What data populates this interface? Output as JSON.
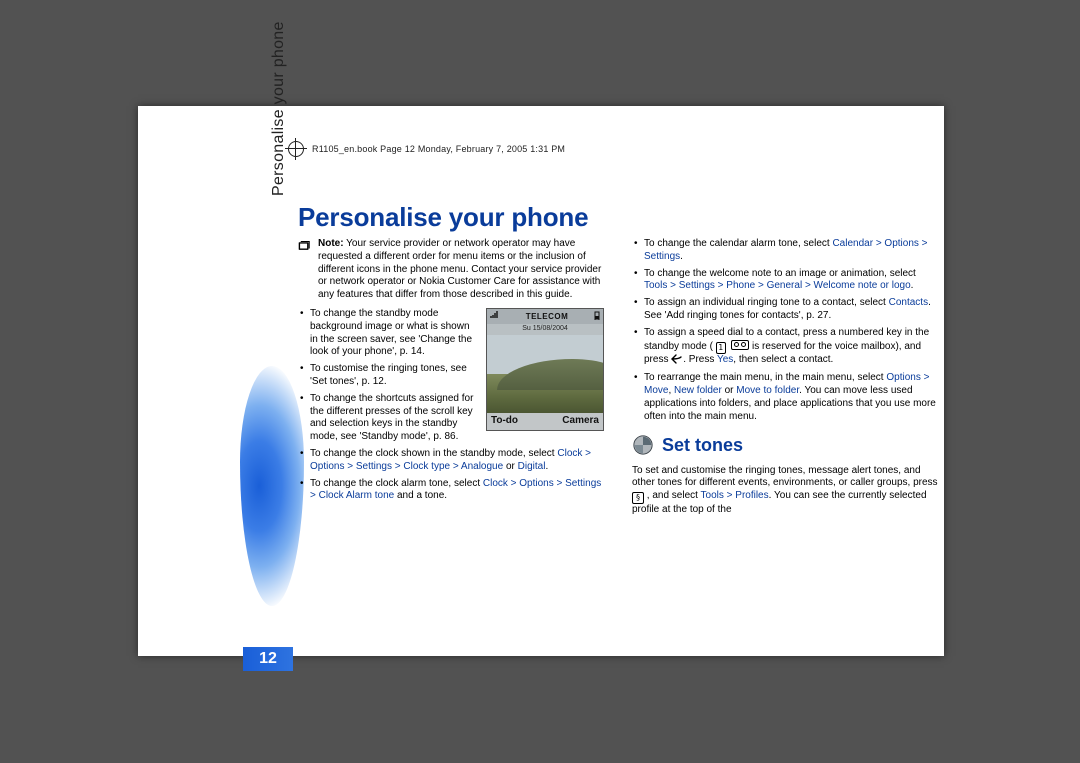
{
  "header_print_line": "R1105_en.book  Page 12  Monday, February 7, 2005  1:31 PM",
  "vtab": "Personalise your phone",
  "page_number": "12",
  "title": "Personalise your phone",
  "note_label": "Note:",
  "note_text": " Your service provider or network operator may have requested a different order for menu items or the inclusion of different icons in the phone menu. Contact your service provider or network operator or Nokia Customer Care for assistance with any features that differ from those described in this guide.",
  "left_bullets": {
    "b1": "To change the standby mode background image or what is shown in the screen saver, see 'Change the look of your phone', p. 14.",
    "b2": "To customise the ringing tones, see 'Set tones', p. 12.",
    "b3": "To change the shortcuts assigned for the different presses of the scroll key and selection keys in the standby mode, see 'Standby mode', p. 86.",
    "b4_pre": "To change the clock shown in the standby mode, select ",
    "b4_link": "Clock > Options > Settings > Clock type > Analogue",
    "b4_mid": " or ",
    "b4_link2": "Digital",
    "b4_post": ".",
    "b5_pre": "To change the clock alarm tone, select ",
    "b5_link": "Clock > Options > Settings > Clock Alarm tone",
    "b5_post": " and a tone."
  },
  "right_bullets": {
    "r1_pre": "To change the calendar alarm tone, select ",
    "r1_link": "Calendar > Options > Settings",
    "r1_post": ".",
    "r2_pre": "To change the welcome note to an image or animation, select ",
    "r2_link": "Tools > Settings > Phone > General > Welcome note or logo",
    "r2_post": ".",
    "r3_pre": "To assign an individual ringing tone to a contact, select ",
    "r3_link": "Contacts",
    "r3_post": ". See 'Add ringing tones for contacts', p. 27.",
    "r4_pre": "To assign a speed dial to a contact, press a numbered key in the standby mode ( ",
    "r4_mid": " is reserved for the voice mailbox), and press ",
    "r4_mid2": ". Press ",
    "r4_link": "Yes",
    "r4_post": ", then select a contact.",
    "r5_pre": "To rearrange the main menu, in the main menu, select ",
    "r5_link1": "Options > Move",
    "r5_mid1": ", ",
    "r5_link2": "New folder",
    "r5_mid2": " or ",
    "r5_link3": "Move to folder",
    "r5_post": ". You can move less used applications into folders, and place applications that you use more often into the main menu."
  },
  "section_title": "Set tones",
  "section_para_pre": "To set and customise the ringing tones, message alert tones, and other tones for different events, environments, or caller groups, press ",
  "section_para_mid": " , and select ",
  "section_para_link": "Tools > Profiles",
  "section_para_post": ". You can see the currently selected profile at the top of the",
  "phone": {
    "operator": "TELECOM",
    "date": "Su 15/08/2004",
    "left_softkey": "To-do",
    "right_softkey": "Camera"
  }
}
